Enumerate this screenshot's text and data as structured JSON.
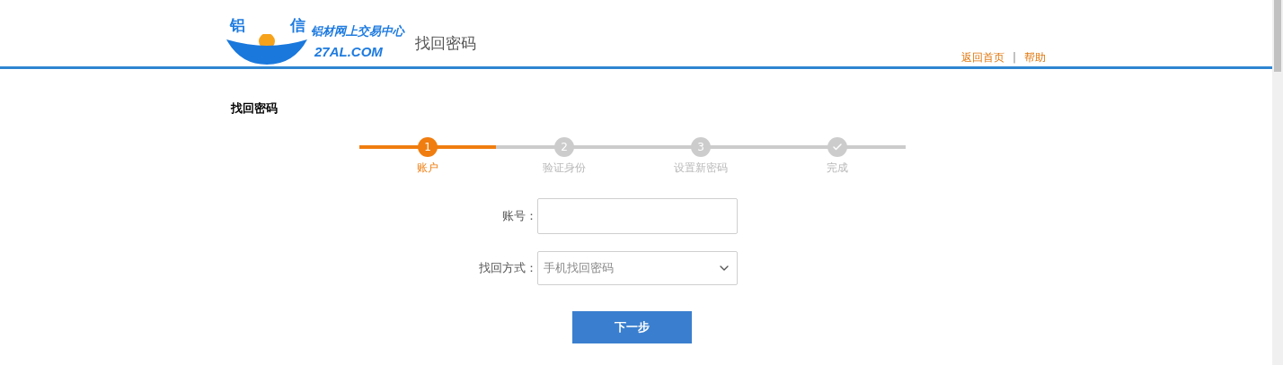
{
  "header": {
    "logo": {
      "char_left": "铝",
      "char_right": "信",
      "name": "铝材网上交易中心",
      "domain": "27AL.COM"
    },
    "title": "找回密码",
    "links": [
      {
        "label": "返回首页"
      },
      {
        "label": "帮助"
      }
    ],
    "separator": "|"
  },
  "section_title": "找回密码",
  "steps": [
    {
      "kind": "number",
      "number": "1",
      "label": "账户",
      "selected": true
    },
    {
      "kind": "number",
      "number": "2",
      "label": "验证身份",
      "selected": false
    },
    {
      "kind": "number",
      "number": "3",
      "label": "设置新密码",
      "selected": false
    },
    {
      "kind": "check",
      "label": "完成",
      "selected": false
    }
  ],
  "form": {
    "account_label": "账号：",
    "method_label": "找回方式：",
    "method_value": "手机找回密码",
    "submit": "下一步"
  }
}
